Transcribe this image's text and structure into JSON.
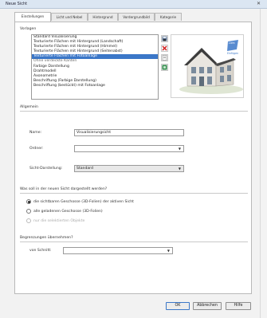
{
  "window": {
    "title": "Neue Sicht",
    "close_glyph": "✕"
  },
  "tabs": [
    {
      "label": "Einstellungen",
      "active": true
    },
    {
      "label": "Licht und Nebel",
      "active": false
    },
    {
      "label": "Hintergrund",
      "active": false
    },
    {
      "label": "Vordergrundbild",
      "active": false
    },
    {
      "label": "Kategorie",
      "active": false
    }
  ],
  "vorlagen": {
    "label": "Vorlagen",
    "items": [
      {
        "label": "Standard Visualisierung",
        "selected": false
      },
      {
        "label": "Texturierte Flächen mit Hintergrund (Landschaft)",
        "selected": false
      },
      {
        "label": "Texturierte Flächen mit Hintergrund (Himmel)",
        "selected": false
      },
      {
        "label": "Texturierte Flächen mit Hintergrund (Seitenabst)",
        "selected": false
      },
      {
        "label": "Texturierte Flächen mit Fotoanlage",
        "selected": true
      },
      {
        "label": "Ohne verdeckte Kanten",
        "selected": false
      },
      {
        "label": "Farbige Darstellung",
        "selected": false
      },
      {
        "label": "Drahtmodell",
        "selected": false
      },
      {
        "label": "Axonometrie",
        "selected": false
      },
      {
        "label": "Beschriftung (Farbige Darstellung)",
        "selected": false
      },
      {
        "label": "Beschriftung (bestückt) mit Fotoanlage",
        "selected": false
      }
    ],
    "icons": [
      "save-template-icon",
      "delete-template-icon",
      "new-template-icon",
      "import-template-icon"
    ]
  },
  "preview": {
    "badge_line1": "Licht",
    "badge_line2": "Einfügen"
  },
  "allgemein": {
    "heading": "Allgemein",
    "name_label": "Name:",
    "name_value": "Visualisierungsicht",
    "ordner_label": "Ordner:",
    "ordner_value": "",
    "sicht_label": "Sicht-Darstellung:",
    "sicht_value": "Standard"
  },
  "geschosse": {
    "heading": "Was soll in der neuen Sicht dargestellt werden?",
    "options": [
      {
        "label": "die sichtbaren Geschosse (3D-Folien) der aktiven Sicht",
        "checked": true,
        "disabled": false
      },
      {
        "label": "alle geladenen Geschosse (3D-Folien)",
        "checked": false,
        "disabled": false
      },
      {
        "label": "nur die selektierten Objekte",
        "checked": false,
        "disabled": true
      }
    ]
  },
  "begrenzungen": {
    "heading": "Begrenzungen übernehmen?",
    "schnitt_label": "von Schnitt:",
    "schnitt_value": ""
  },
  "buttons": {
    "ok": "OK",
    "abbrechen": "Abbrechen",
    "hilfe": "Hilfe"
  },
  "colors": {
    "selection": "#3b77c8",
    "titlebar": "#dbe6f2"
  }
}
